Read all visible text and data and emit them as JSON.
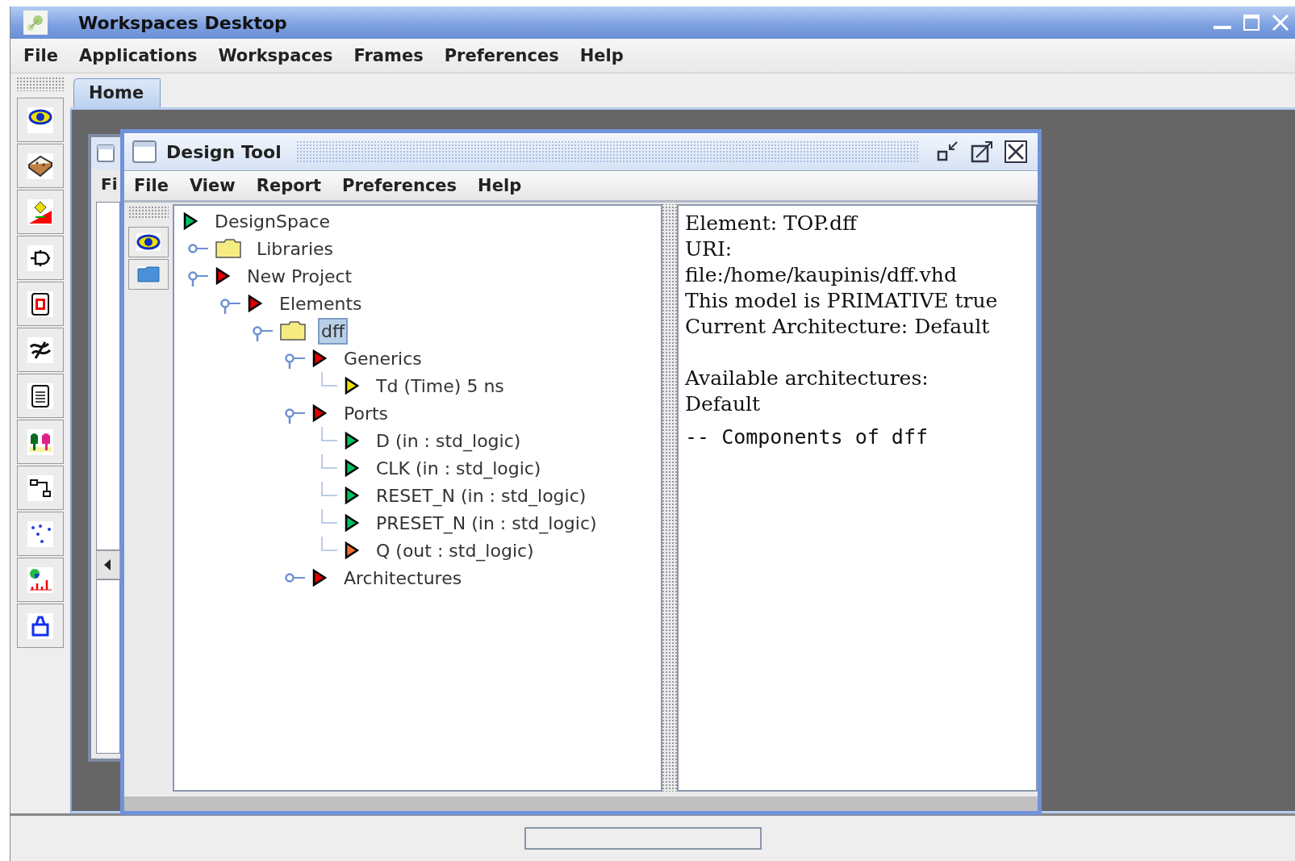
{
  "window": {
    "title": "Workspaces Desktop"
  },
  "menu": [
    "File",
    "Applications",
    "Workspaces",
    "Frames",
    "Preferences",
    "Help"
  ],
  "tabs": [
    {
      "label": "Home",
      "selected": true
    }
  ],
  "background_frame": {
    "menu": [
      "Fi"
    ]
  },
  "design_tool": {
    "title": "Design Tool",
    "menu": [
      "File",
      "View",
      "Report",
      "Preferences",
      "Help"
    ],
    "tree": [
      {
        "label": "DesignSpace",
        "kind": "arrow",
        "color": "#00c060",
        "selected": false,
        "children": [
          {
            "label": "Libraries",
            "kind": "folder",
            "selected": false,
            "expanded": false
          },
          {
            "label": "New Project",
            "kind": "arrow",
            "color": "#e00000",
            "selected": false,
            "expanded": true,
            "children": [
              {
                "label": "Elements",
                "kind": "arrow",
                "color": "#e00000",
                "selected": false,
                "expanded": true,
                "children": [
                  {
                    "label": "dff",
                    "kind": "folder",
                    "selected": true,
                    "expanded": true,
                    "children": [
                      {
                        "label": "Generics",
                        "kind": "arrow",
                        "color": "#e00000",
                        "selected": false,
                        "expanded": true,
                        "children": [
                          {
                            "label": "Td (Time) 5 ns",
                            "kind": "arrow",
                            "color": "#f0e000",
                            "selected": false
                          }
                        ]
                      },
                      {
                        "label": "Ports",
                        "kind": "arrow",
                        "color": "#e00000",
                        "selected": false,
                        "expanded": true,
                        "children": [
                          {
                            "label": "D (in : std_logic)",
                            "kind": "arrow",
                            "color": "#00c060",
                            "selected": false
                          },
                          {
                            "label": "CLK (in : std_logic)",
                            "kind": "arrow",
                            "color": "#00c060",
                            "selected": false
                          },
                          {
                            "label": "RESET_N (in : std_logic)",
                            "kind": "arrow",
                            "color": "#00c060",
                            "selected": false
                          },
                          {
                            "label": "PRESET_N (in : std_logic)",
                            "kind": "arrow",
                            "color": "#00c060",
                            "selected": false
                          },
                          {
                            "label": "Q (out : std_logic)",
                            "kind": "arrow",
                            "color": "#f07030",
                            "selected": false
                          }
                        ]
                      },
                      {
                        "label": "Architectures",
                        "kind": "arrow",
                        "color": "#e00000",
                        "selected": false,
                        "expanded": false
                      }
                    ]
                  }
                ]
              }
            ]
          }
        ]
      }
    ],
    "details": {
      "paragraphs": [
        [
          "Element: TOP.dff",
          "URI:",
          "file:/home/kaupinis/dff.vhd",
          "This model is PRIMATIVE true",
          "Current Architecture: Default"
        ],
        [
          "Available architectures:",
          "Default"
        ]
      ],
      "code": "-- Components of dff"
    }
  }
}
